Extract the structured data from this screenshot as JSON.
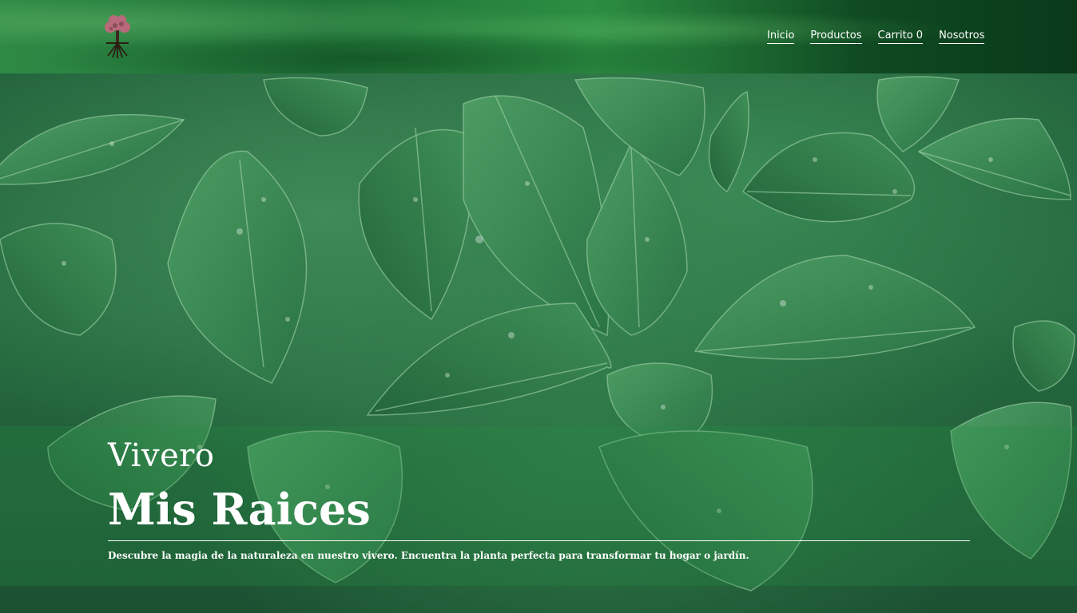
{
  "header": {
    "logo_icon": "tree-roots-logo-icon",
    "nav": [
      {
        "label": "Inicio"
      },
      {
        "label": "Productos"
      },
      {
        "label": "Carrito 0"
      },
      {
        "label": "Nosotros"
      }
    ]
  },
  "hero": {
    "subtitle": "Vivero",
    "title": "Mis Raices",
    "description": "Descubre la magia de la naturaleza en nuestro vivero. Encuentra la planta perfecta para transformar tu hogar o jardín."
  },
  "colors": {
    "text": "#ffffff",
    "leaf_dark": "#1d5a34",
    "leaf_light": "#4a9a60"
  },
  "background_icon": "leaves-background-image"
}
